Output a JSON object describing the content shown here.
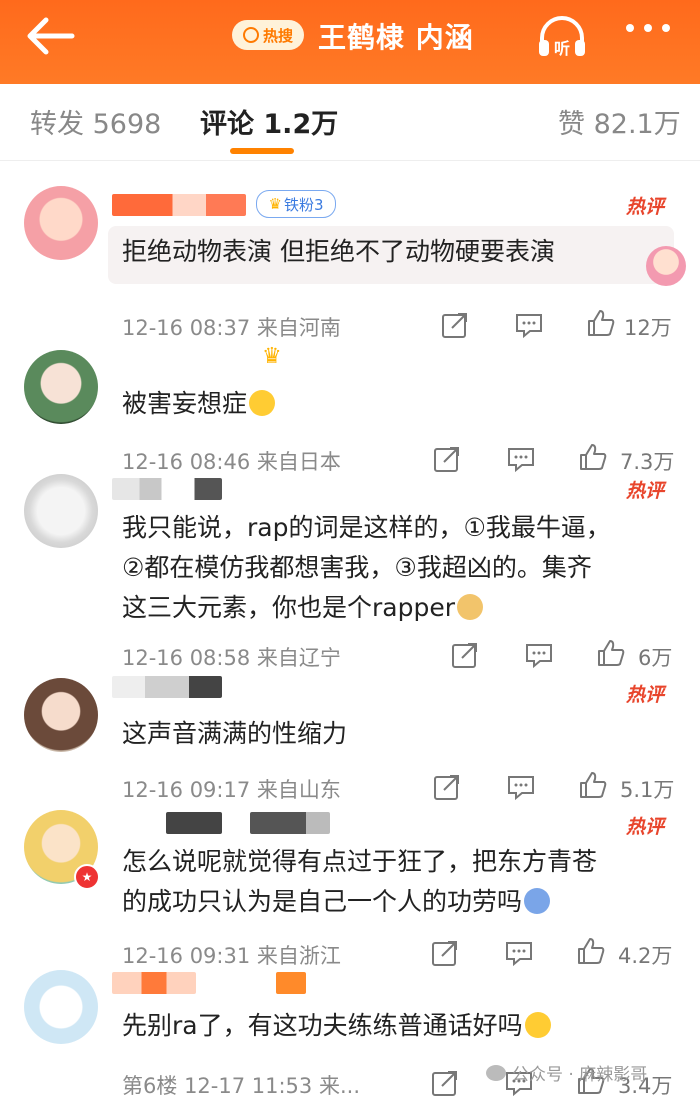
{
  "header": {
    "hot_badge": "热搜",
    "topic": "王鹤棣 内涵",
    "listen_label": "听"
  },
  "tabs": [
    {
      "label": "转发 5698"
    },
    {
      "label": "评论 1.2万"
    },
    {
      "label": "赞 82.1万"
    }
  ],
  "comments": [
    {
      "text": "拒绝动物表演 但拒绝不了动物硬要表演",
      "time": "12-16 08:37",
      "location": "来自河南",
      "likes": "12万",
      "badge": "铁粉3",
      "hot": "热评"
    },
    {
      "text": "被害妄想症",
      "time": "12-16 08:46",
      "location": "来自日本",
      "likes": "7.3万",
      "hot": ""
    },
    {
      "text": "我只能说，rap的词是这样的，①我最牛逼，\n②都在模仿我都想害我，③我超凶的。集齐\n这三大元素，你也是个rapper",
      "time": "12-16 08:58",
      "location": "来自辽宁",
      "likes": "6万",
      "hot": "热评"
    },
    {
      "text": "这声音满满的性缩力",
      "time": "12-16 09:17",
      "location": "来自山东",
      "likes": "5.1万",
      "hot": "热评"
    },
    {
      "text": "怎么说呢就觉得有点过于狂了，把东方青苍\n的成功只认为是自己一个人的功劳吗",
      "time": "12-16 09:31",
      "location": "来自浙江",
      "likes": "4.2万",
      "hot": "热评"
    },
    {
      "text": "先别ra了，有这功夫练练普通话好吗",
      "time": "12-17 11:53",
      "location": "来...",
      "likes": "3.4万",
      "floor": "第6楼",
      "hot": ""
    }
  ],
  "watermark": "公众号 · 麻辣影哥",
  "colors": {
    "brand": "#ff7a26",
    "hot": "#e8452c",
    "tab_underline": "#ff8200"
  }
}
